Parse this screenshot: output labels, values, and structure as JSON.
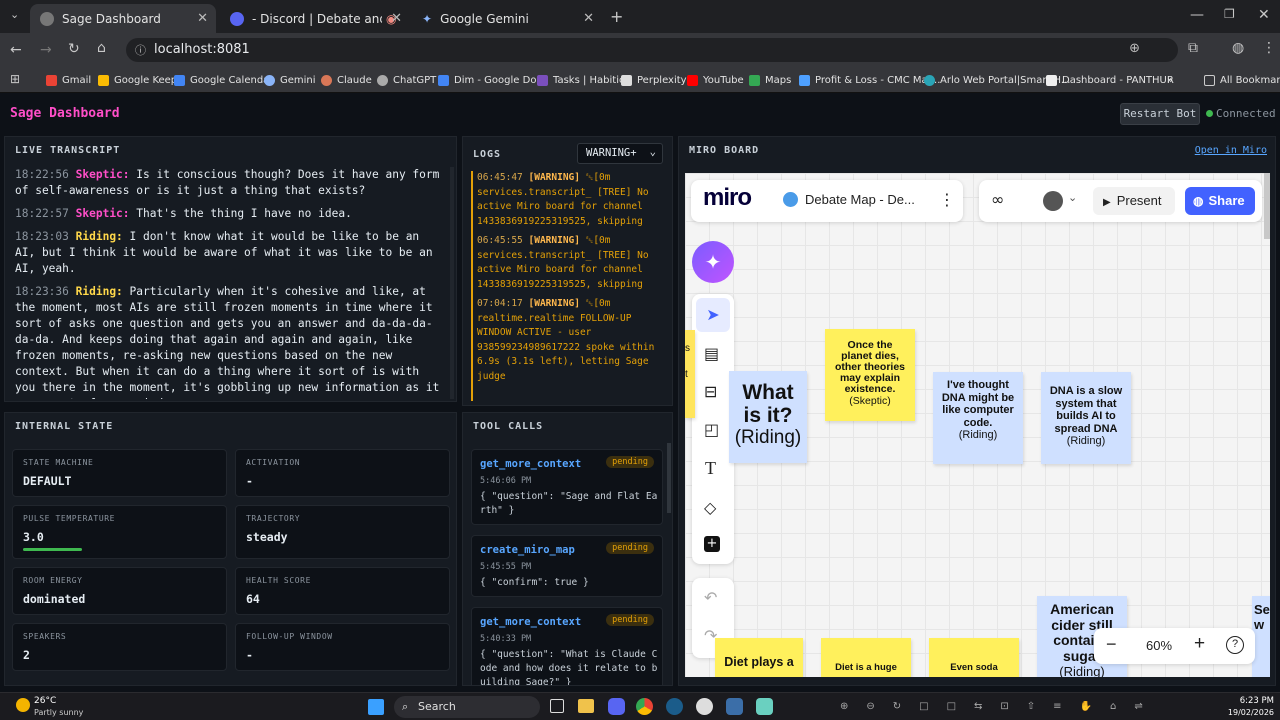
{
  "browser": {
    "tabs": [
      {
        "title": "Sage Dashboard",
        "active": true
      },
      {
        "title": "- Discord | Debate and let Sage n",
        "active": false
      },
      {
        "title": "Google Gemini",
        "active": false
      }
    ],
    "url": "localhost:8081",
    "bookmarks": [
      "Gmail",
      "Google Keep",
      "Google Calendar",
      "Gemini",
      "Claude",
      "ChatGPT",
      "Dim - Google Docs",
      "Tasks | Habitica",
      "Perplexity",
      "YouTube",
      "Maps",
      "Profit & Loss - CMC Mar...",
      "Arlo Web Portal|Smart H...",
      "Dashboard - PANTHUR"
    ],
    "all_bookmarks": "All Bookmarks"
  },
  "app": {
    "title": "Sage Dashboard",
    "restart_label": "Restart Bot",
    "status": "Connected"
  },
  "transcript": {
    "header": "LIVE TRANSCRIPT",
    "entries": [
      {
        "time": "18:22:56",
        "speaker": "Skeptic:",
        "text": "Is it conscious though? Does it have any form of self-awareness or is it just a thing that exists?"
      },
      {
        "time": "18:22:57",
        "speaker": "Skeptic:",
        "text": "That's the thing I have no idea."
      },
      {
        "time": "18:23:03",
        "speaker": "Riding:",
        "text": "I don't know what it would be like to be an AI, but I think it would be aware of what it was like to be an AI, yeah."
      },
      {
        "time": "18:23:36",
        "speaker": "Riding:",
        "text": "Particularly when it's cohesive and like, at the moment, most AIs are still frozen moments in time where it sort of asks one question and gets you an answer and da-da-da-da-da. And keeps doing that again and again and again, like frozen moments, re-asking new questions based on the new context. But when it can do a thing where it sort of is with you there in the moment, it's gobbling up new information as it comes out of your mind."
      }
    ]
  },
  "logs": {
    "header": "LOGS",
    "filter": "WARNING+",
    "entries": [
      {
        "time": "06:45:47",
        "level": "[WARNING]",
        "code": "␛[0m",
        "text": "services.transcript_ [TREE] No active Miro board for channel 1433836919225319525, skipping"
      },
      {
        "time": "06:45:55",
        "level": "[WARNING]",
        "code": "␛[0m",
        "text": "services.transcript_ [TREE] No active Miro board for channel 1433836919225319525, skipping"
      },
      {
        "time": "07:04:17",
        "level": "[WARNING]",
        "code": "␛[0m",
        "text": "realtime.realtime FOLLOW-UP WINDOW ACTIVE - user 938599234989617222 spoke within 6.9s (3.1s left), letting Sage judge"
      }
    ]
  },
  "miro_panel": {
    "header": "MIRO BOARD",
    "open_link": "Open in Miro",
    "logo": "miro",
    "board_name": "Debate Map - De...",
    "present": "Present",
    "share": "Share",
    "zoom": "60%",
    "stickies": {
      "what": {
        "title": "What is it?",
        "who": "(Riding)"
      },
      "planet": {
        "text": "Once the planet dies, other theories may explain existence.",
        "who": "(Skeptic)"
      },
      "dna_code": {
        "text": "I've thought DNA might be like computer code.",
        "who": "(Riding)"
      },
      "dna_slow": {
        "text": "DNA is a slow system that builds AI to spread DNA",
        "who": "(Riding)"
      },
      "cider": {
        "text": "American cider still contains sugar",
        "who": "(Riding)"
      },
      "diet_plays": {
        "text": "Diet plays a"
      },
      "diet_huge": {
        "text": "Diet is a huge"
      },
      "even_soda": {
        "text": "Even soda"
      },
      "left_partial": {
        "text": "s t"
      },
      "right_partial": {
        "text": "Se w"
      }
    }
  },
  "internal_state": {
    "header": "INTERNAL STATE",
    "cards": [
      {
        "key": "STATE MACHINE",
        "value": "DEFAULT"
      },
      {
        "key": "ACTIVATION",
        "value": "-"
      },
      {
        "key": "PULSE TEMPERATURE",
        "value": "3.0"
      },
      {
        "key": "TRAJECTORY",
        "value": "steady"
      },
      {
        "key": "ROOM ENERGY",
        "value": "dominated"
      },
      {
        "key": "HEALTH SCORE",
        "value": "64"
      },
      {
        "key": "SPEAKERS",
        "value": "2"
      },
      {
        "key": "FOLLOW-UP WINDOW",
        "value": "-"
      }
    ],
    "pulse_level": 0.3
  },
  "tool_calls": {
    "header": "TOOL CALLS",
    "items": [
      {
        "name": "get_more_context",
        "status": "pending",
        "time": "5:46:06 PM",
        "args": "{ \"question\": \"Sage and Flat Earth\" }"
      },
      {
        "name": "create_miro_map",
        "status": "pending",
        "time": "5:45:55 PM",
        "args": "{ \"confirm\": true }"
      },
      {
        "name": "get_more_context",
        "status": "pending",
        "time": "5:40:33 PM",
        "args": "{ \"question\": \"What is Claude Code and how does it relate to building Sage?\" }"
      }
    ]
  },
  "taskbar": {
    "weather_temp": "26°C",
    "weather_desc": "Partly sunny",
    "search": "Search",
    "time": "6:23 PM",
    "date": "19/02/2026"
  },
  "colors": {
    "accent": "#ff4ec8",
    "speaker_skeptic": "#ff4ec8",
    "speaker_riding": "#ffd84a",
    "link": "#58a6ff",
    "warning": "#e3a008",
    "ok": "#3fb950"
  }
}
